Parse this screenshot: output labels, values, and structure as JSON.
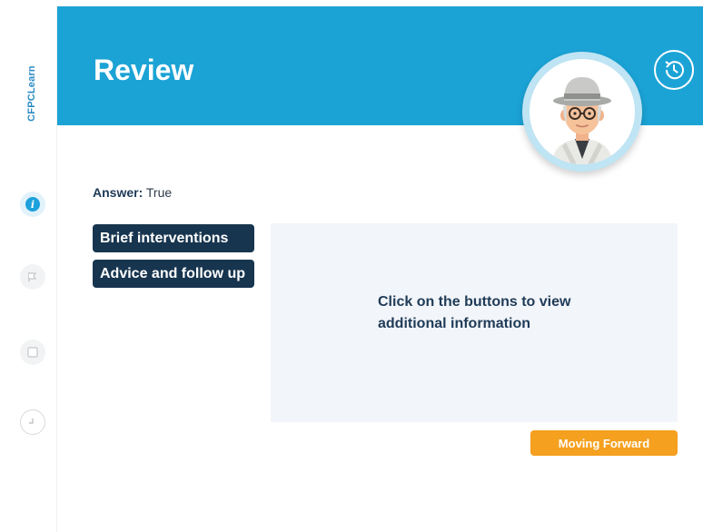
{
  "brand": {
    "logo_text": "CFPCLearn"
  },
  "header": {
    "title": "Review"
  },
  "sidebar": {
    "items": [
      {
        "name": "info",
        "icon": "info-icon",
        "glyph": "i",
        "active": true
      },
      {
        "name": "flag",
        "icon": "flag-icon",
        "active": false
      },
      {
        "name": "notes",
        "icon": "notes-icon",
        "active": false
      },
      {
        "name": "timer",
        "icon": "clock-icon",
        "active": false
      }
    ]
  },
  "content": {
    "answer_label": "Answer:",
    "answer_value": "True",
    "buttons": [
      {
        "label": "Brief interventions"
      },
      {
        "label": "Advice and follow up"
      }
    ],
    "panel_text": "Click on the buttons to view additional information",
    "cta_label": "Moving Forward"
  },
  "colors": {
    "header": "#1ba3d6",
    "button_dark": "#17354f",
    "cta": "#f5a01f",
    "panel": "#f2f5f9"
  }
}
